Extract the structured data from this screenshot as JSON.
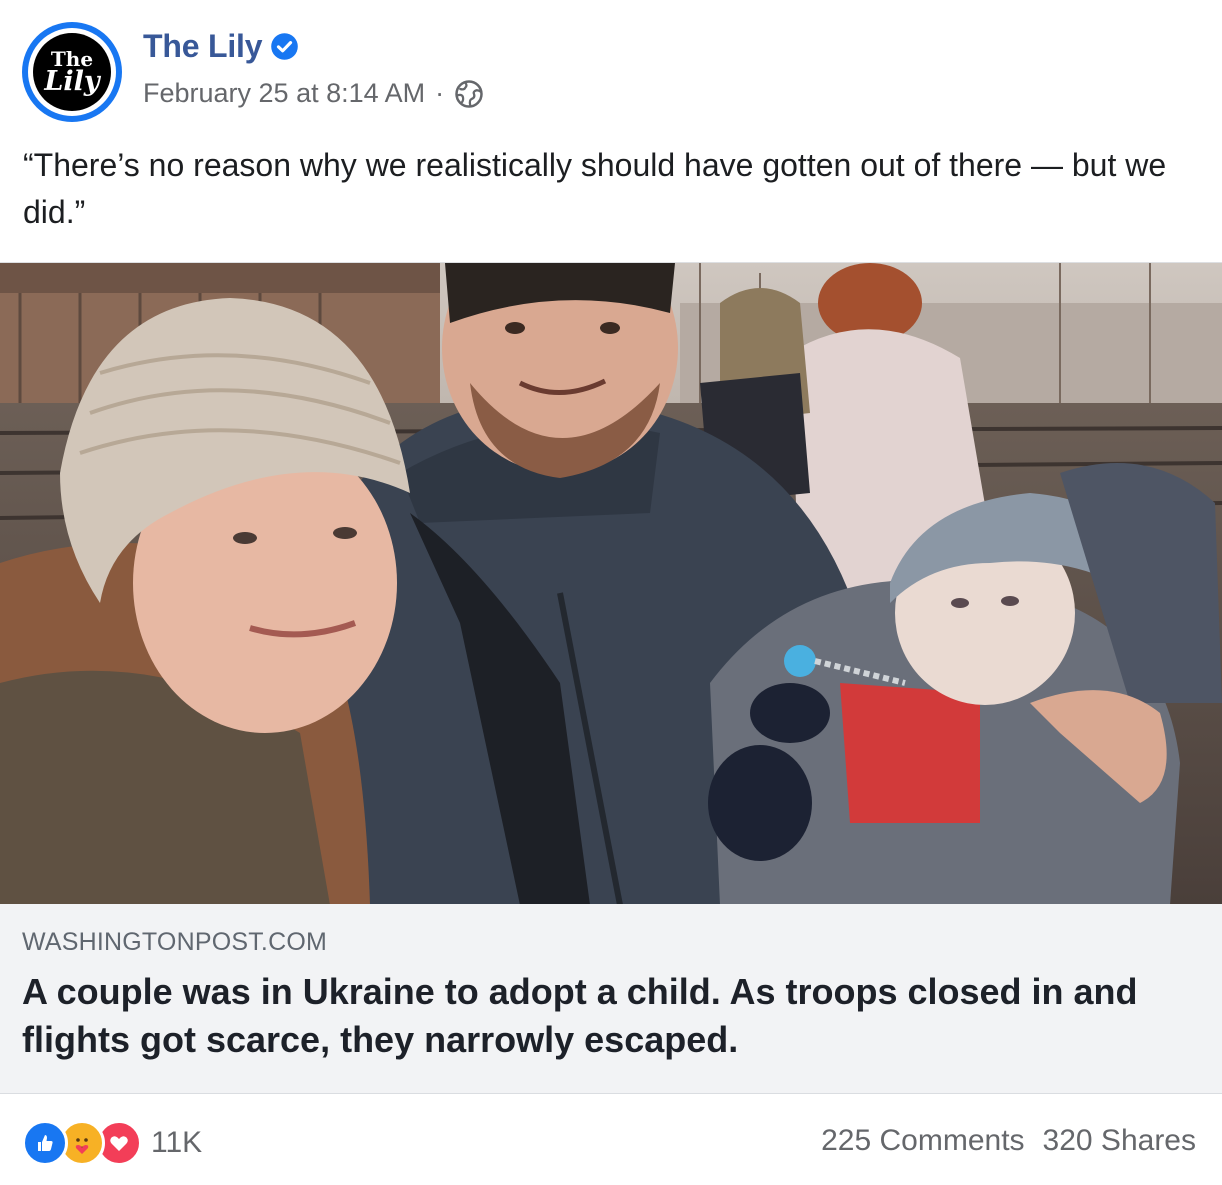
{
  "page": {
    "name": "The Lily",
    "avatar_line1": "The",
    "avatar_line2": "Lily",
    "verified": true
  },
  "post": {
    "timestamp": "February 25 at 8:14 AM",
    "separator": "·",
    "audience_icon": "globe-icon",
    "caption": "“There’s no reason why we realistically should have gotten out of there — but we did.”"
  },
  "link_preview": {
    "domain": "WASHINGTONPOST.COM",
    "title": "A couple was in Ukraine to adopt a child. As troops closed in and flights got scarce, they narrowly escaped."
  },
  "engagement": {
    "reaction_icons": [
      "like-icon",
      "care-icon",
      "love-icon"
    ],
    "reaction_count": "11K",
    "comments": "225 Comments",
    "shares": "320 Shares"
  },
  "colors": {
    "brand_blue": "#1877f2",
    "page_name": "#385898",
    "secondary_text": "#65676b",
    "link_bg": "#f2f3f5"
  }
}
